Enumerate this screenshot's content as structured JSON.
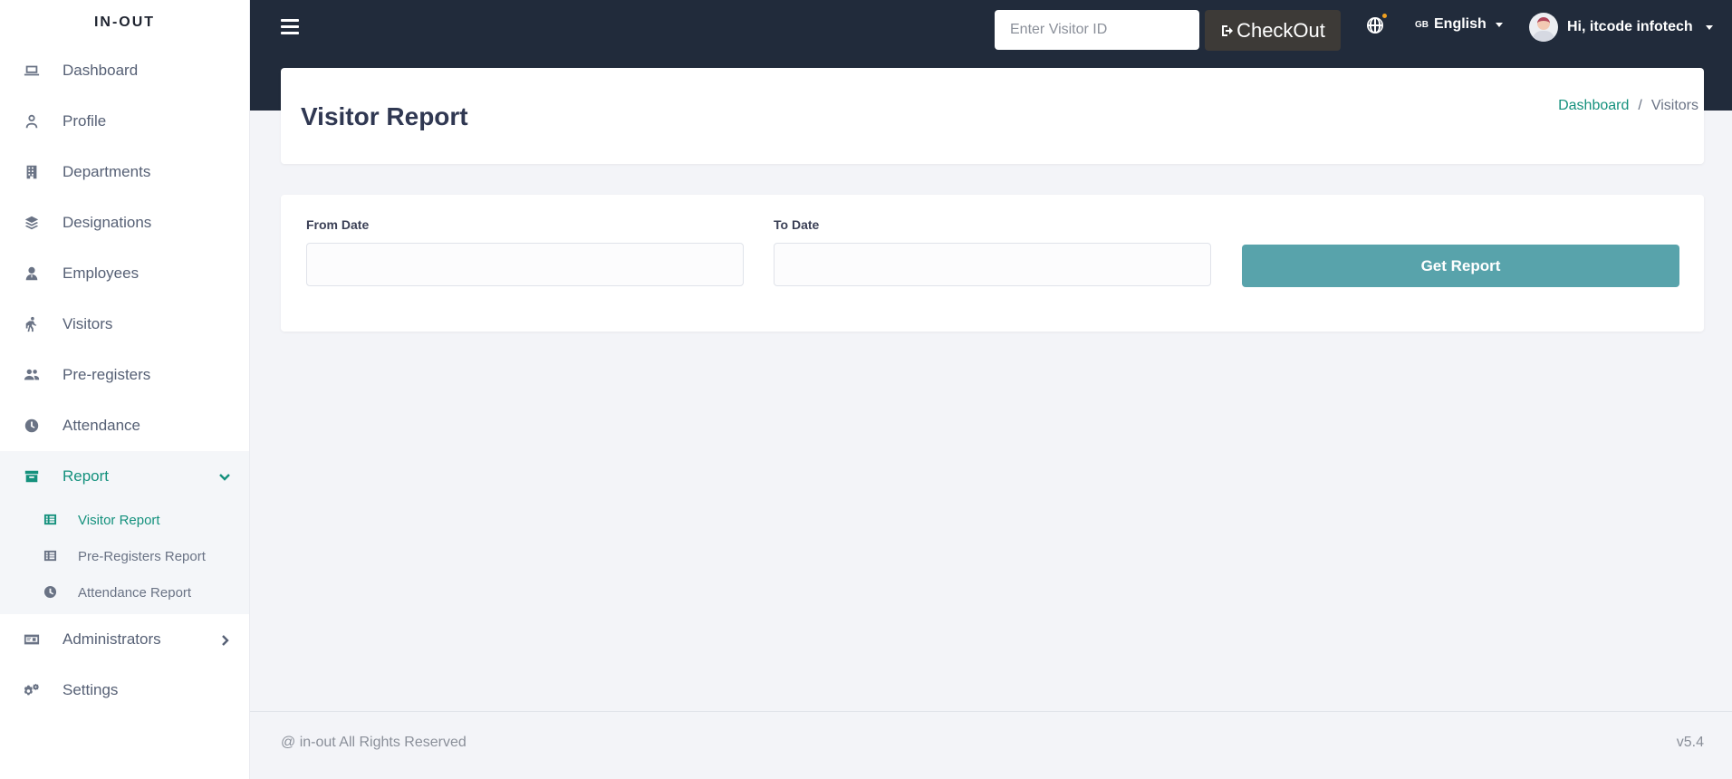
{
  "brand": "IN-OUT",
  "sidebar": {
    "items": [
      {
        "label": "Dashboard",
        "icon": "laptop-icon"
      },
      {
        "label": "Profile",
        "icon": "user-icon"
      },
      {
        "label": "Departments",
        "icon": "building-icon"
      },
      {
        "label": "Designations",
        "icon": "layers-icon"
      },
      {
        "label": "Employees",
        "icon": "user-tie-icon"
      },
      {
        "label": "Visitors",
        "icon": "walking-icon"
      },
      {
        "label": "Pre-registers",
        "icon": "users-icon"
      },
      {
        "label": "Attendance",
        "icon": "clock-icon"
      },
      {
        "label": "Report",
        "icon": "archive-icon",
        "active": true
      },
      {
        "label": "Administrators",
        "icon": "id-card-icon"
      },
      {
        "label": "Settings",
        "icon": "gears-icon"
      }
    ],
    "report_submenu": [
      {
        "label": "Visitor Report",
        "icon": "list-icon",
        "active": true
      },
      {
        "label": "Pre-Registers Report",
        "icon": "list-icon"
      },
      {
        "label": "Attendance Report",
        "icon": "clock-icon"
      }
    ]
  },
  "header": {
    "visitor_placeholder": "Enter Visitor ID",
    "checkout_label": "CheckOut",
    "language_flag": "GB",
    "language": "English",
    "user_greeting": "Hi, itcode infotech"
  },
  "page": {
    "title": "Visitor Report",
    "breadcrumb": {
      "home": "Dashboard",
      "separator": "/",
      "current": "Visitors"
    }
  },
  "form": {
    "from_label": "From Date",
    "to_label": "To Date",
    "from_value": "",
    "to_value": "",
    "submit_label": "Get Report"
  },
  "footer": {
    "copyright": "@ in-out All Rights Reserved",
    "version": "v5.4"
  },
  "colors": {
    "accent": "#14917d",
    "header_bg": "#212b3b",
    "button": "#58a3ab",
    "checkout_bg": "#3d3a37"
  }
}
